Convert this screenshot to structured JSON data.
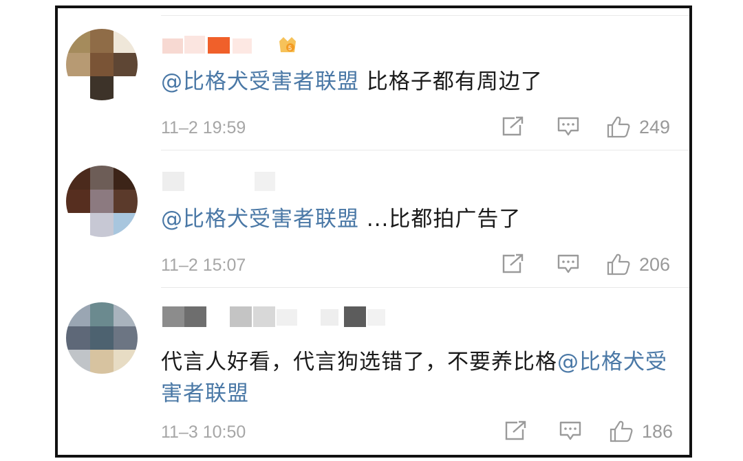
{
  "comments": [
    {
      "mention": "@比格犬受害者联盟",
      "text": " 比格子都有周边了",
      "time": "11–2 19:59",
      "likes": "249"
    },
    {
      "mention": "@比格犬受害者联盟",
      "text": " ...比都拍广告了",
      "time": "11–2 15:07",
      "likes": "206"
    },
    {
      "text_before": "代言人好看，代言狗选错了，不要养比格",
      "mention": "@比格犬受害者联盟",
      "time": "11–3 10:50",
      "likes": "186"
    }
  ],
  "icons": {
    "share": "share-icon",
    "comment": "comment-icon",
    "like": "thumbs-up-icon",
    "badge": "vip-badge-icon"
  },
  "colors": {
    "mention": "#4a78a6",
    "text": "#1a1a1a",
    "meta": "#a6a6a6",
    "frame": "#111111"
  }
}
